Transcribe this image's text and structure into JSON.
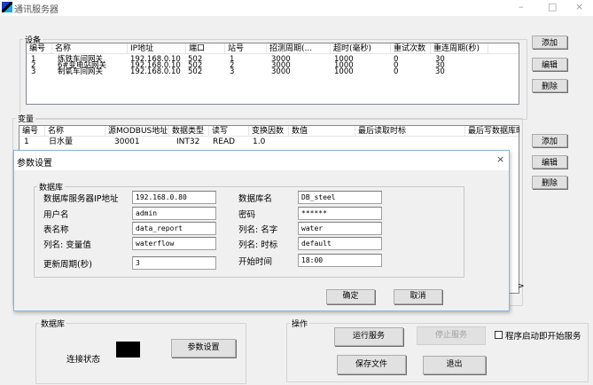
{
  "window": {
    "title": "通讯服务器",
    "minimize": "–",
    "maximize": "□",
    "close": "×"
  },
  "devices": {
    "legend": "设备",
    "columns": [
      "编号",
      "名称",
      "IP地址",
      "端口",
      "站号",
      "招测周期(...",
      "超时(毫秒)",
      "重试次数",
      "重连周期(秒)"
    ],
    "rows": [
      [
        "1",
        "炼铁车间网关",
        "192.168.0.10",
        "502",
        "1",
        "3000",
        "1000",
        "0",
        "30"
      ],
      [
        "2",
        "6#变电站网关",
        "192.168.0.10",
        "502",
        "2",
        "3000",
        "1000",
        "0",
        "30"
      ],
      [
        "3",
        "制氧车间网关",
        "192.168.0.10",
        "502",
        "3",
        "3000",
        "1000",
        "0",
        "30"
      ]
    ],
    "buttons": {
      "add": "添加",
      "edit": "编辑",
      "delete": "删除"
    }
  },
  "variables": {
    "legend": "变量",
    "columns": [
      "编号",
      "名称",
      "源MODBUS地址",
      "数据类型",
      "读写",
      "变换因数",
      "数值",
      "最后读取时标",
      "最后写数据库时"
    ],
    "rows": [
      [
        "1",
        "日水量",
        "30001",
        "INT32",
        "READ",
        "1.0",
        "",
        "",
        ""
      ]
    ],
    "buttons": {
      "add": "添加",
      "edit": "编辑",
      "delete": "删除"
    },
    "scroll_right": ">"
  },
  "dialog": {
    "title": "参数设置",
    "close": "×",
    "group": "数据库",
    "fields": {
      "db_ip": {
        "label": "数据库服务器IP地址",
        "value": "192.168.0.80"
      },
      "db_name": {
        "label": "数据库名",
        "value": "DB_steel"
      },
      "user": {
        "label": "用户名",
        "value": "admin"
      },
      "password": {
        "label": "密码",
        "value": "******"
      },
      "table": {
        "label": "表名称",
        "value": "data_report"
      },
      "col_name": {
        "label": "列名: 名字",
        "value": "water"
      },
      "col_value": {
        "label": "列名: 变量值",
        "value": "waterflow"
      },
      "col_time": {
        "label": "列名: 时标",
        "value": "default"
      },
      "period": {
        "label": "更新周期(秒)",
        "value": "3"
      },
      "start_time": {
        "label": "开始时间",
        "value": "18:00"
      }
    },
    "ok": "确定",
    "cancel": "取消"
  },
  "database": {
    "legend": "数据库",
    "status_label": "连接状态",
    "status_color": "#000000",
    "settings": "参数设置"
  },
  "operations": {
    "legend": "操作",
    "run": "运行服务",
    "stop": "停止服务",
    "autostart": "程序启动即开始服务",
    "autostart_checked": false,
    "save": "保存文件",
    "exit": "退出"
  }
}
